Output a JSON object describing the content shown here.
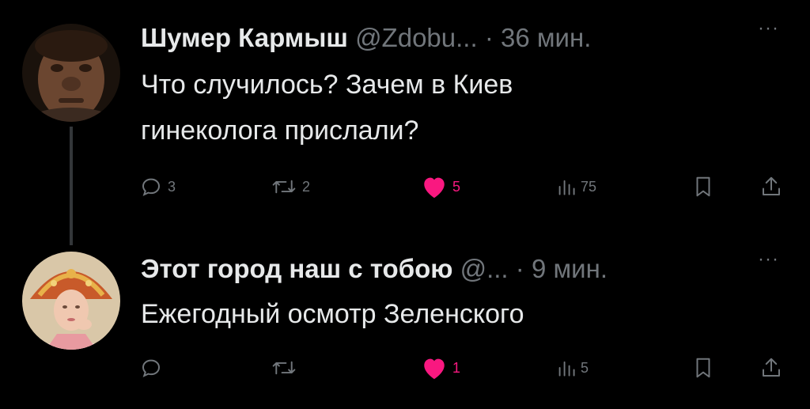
{
  "tweets": [
    {
      "author_name": "Шумер Кармыш",
      "handle": "@Zdobu...",
      "separator": "·",
      "time": "36 мин.",
      "text_lines": [
        "Что случилось? Зачем в Киев",
        "гинеколога прислали?"
      ],
      "avatar_icon": "caveman-face-avatar",
      "stats": {
        "replies": "3",
        "retweets": "2",
        "likes": "5",
        "views": "75"
      },
      "liked": true
    },
    {
      "author_name": "Этот город наш с тобою",
      "handle": "@...",
      "separator": "·",
      "time": "9 мин.",
      "text_lines": [
        "Ежегодный осмотр Зеленского"
      ],
      "avatar_icon": "woman-in-kokoshnik-avatar",
      "stats": {
        "replies": "",
        "retweets": "",
        "likes": "1",
        "views": "5"
      },
      "liked": true
    }
  ],
  "more_label": "···",
  "colors": {
    "background": "#000000",
    "text_primary": "#e7e9ea",
    "text_secondary": "#71767b",
    "like_pink": "#f91880",
    "thread_line": "#333639"
  }
}
